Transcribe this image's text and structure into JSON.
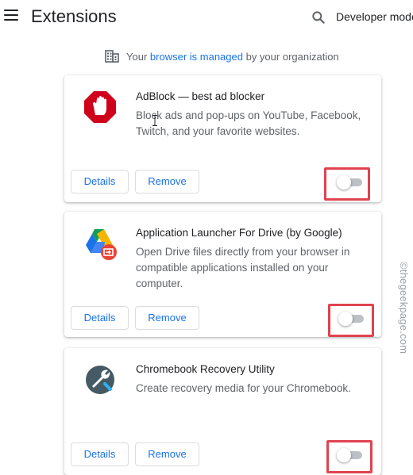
{
  "header": {
    "title": "Extensions",
    "dev_mode_label": "Developer mode"
  },
  "managed": {
    "prefix": "Your ",
    "link": "browser is managed",
    "suffix": " by your organization"
  },
  "extensions": [
    {
      "name": "AdBlock — best ad blocker",
      "description": "Block ads and pop-ups on YouTube, Facebook, Twitch, and your favorite websites.",
      "icon": "adblock-hand-icon",
      "enabled": false
    },
    {
      "name": "Application Launcher For Drive (by Google)",
      "description": "Open Drive files directly from your browser in compatible applications installed on your computer.",
      "icon": "drive-launcher-icon",
      "enabled": false
    },
    {
      "name": "Chromebook Recovery Utility",
      "description": "Create recovery media for your Chromebook.",
      "icon": "wrench-icon",
      "enabled": false
    }
  ],
  "buttons": {
    "details_label": "Details",
    "remove_label": "Remove"
  },
  "watermark": "©thegeekpage.com",
  "colors": {
    "accent": "#1a73e8",
    "highlight": "#e0434f",
    "adblock_red": "#d0021b"
  }
}
